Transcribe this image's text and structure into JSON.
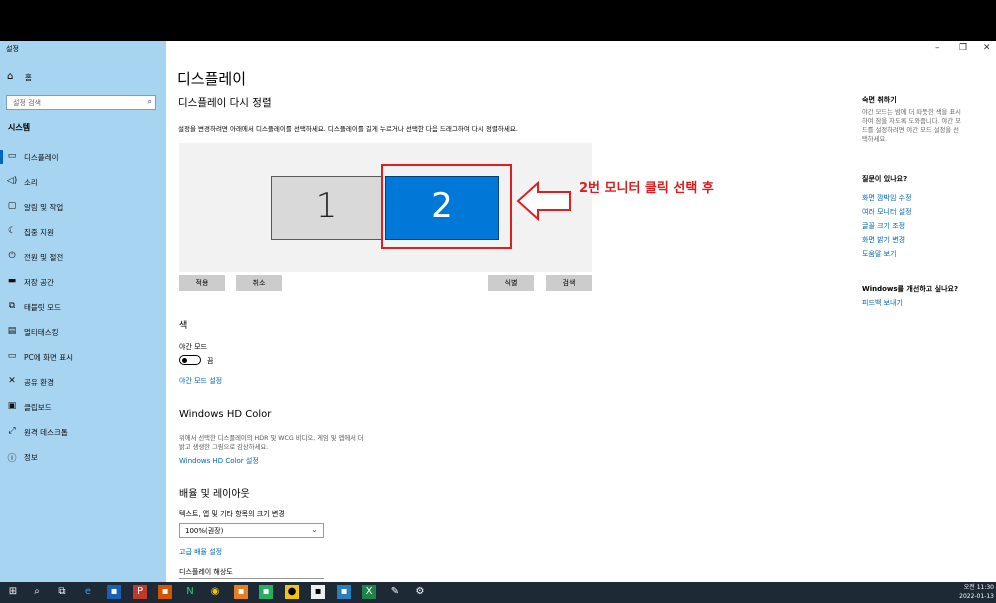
{
  "window": {
    "title": "설정"
  },
  "sidebar": {
    "home": "홈",
    "search_placeholder": "설정 검색",
    "section": "시스템",
    "items": [
      {
        "label": "디스플레이",
        "icon": "monitor-icon"
      },
      {
        "label": "소리",
        "icon": "speaker-icon"
      },
      {
        "label": "알림 및 작업",
        "icon": "notification-icon"
      },
      {
        "label": "집중 지원",
        "icon": "moon-icon"
      },
      {
        "label": "전원 및 절전",
        "icon": "power-icon"
      },
      {
        "label": "저장 공간",
        "icon": "storage-icon"
      },
      {
        "label": "태블릿 모드",
        "icon": "tablet-icon"
      },
      {
        "label": "멀티태스킹",
        "icon": "multitask-icon"
      },
      {
        "label": "PC에 화면 표시",
        "icon": "project-icon"
      },
      {
        "label": "공유 환경",
        "icon": "share-icon"
      },
      {
        "label": "클립보드",
        "icon": "clipboard-icon"
      },
      {
        "label": "원격 데스크톱",
        "icon": "remote-icon"
      },
      {
        "label": "정보",
        "icon": "info-icon"
      }
    ]
  },
  "main": {
    "title": "디스플레이",
    "subtitle": "디스플레이 다시 정렬",
    "description": "설정을 변경하려면 아래에서 디스플레이를 선택하세요. 디스플레이를 길게 누르거나 선택한 다음 드래그하여 다시 정렬하세요.",
    "monitor1": "1",
    "monitor2": "2",
    "annotation": "2번 모니터 클릭 선택 후",
    "buttons": {
      "apply": "적용",
      "cancel": "취소",
      "identify": "식별",
      "detect": "검색"
    },
    "color_section": "색",
    "night_light_label": "야간 모드",
    "night_light_state": "끔",
    "night_light_link": "야간 모드 설정",
    "hd_title": "Windows HD Color",
    "hd_desc_1": "위에서 선택한 디스플레이의 HDR 및 WCG 비디오, 게임 및 앱에서 더",
    "hd_desc_2": "밝고 생생한 그림으로 감상하세요.",
    "hd_link": "Windows HD Color 설정",
    "layout_section": "배율 및 레이아웃",
    "scale_label": "텍스트, 앱 및 기타 항목의 크기 변경",
    "scale_value": "100%(권장)",
    "advanced_scale_link": "고급 배율 설정",
    "resolution_label": "디스플레이 해상도"
  },
  "right_panel": {
    "sleep_title": "숙면 취하기",
    "sleep_text_1": "야간 모드는 밤에 더 따뜻한 색을 표시",
    "sleep_text_2": "하여 잠을 자도록 도와줍니다. 야간 모",
    "sleep_text_3": "드를 설정하려면 야간 모드 설정을 선",
    "sleep_text_4": "택하세요.",
    "question_title": "질문이 있나요?",
    "links": [
      "화면 깜박임 수정",
      "여러 모니터 설정",
      "글꼴 크기 조정",
      "화면 밝기 변경",
      "도움말 보기"
    ],
    "feedback_title": "Windows를 개선하고 싶나요?",
    "feedback_link": "피드백 보내기"
  },
  "taskbar": {
    "time": "오전 11:30",
    "date": "2022-01-13"
  }
}
